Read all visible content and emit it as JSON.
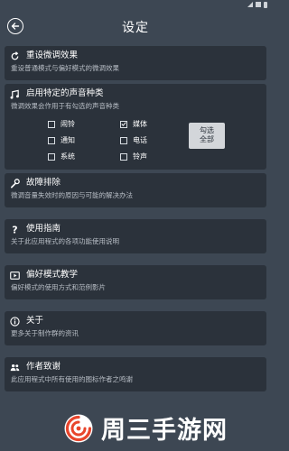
{
  "header": {
    "title": "设定"
  },
  "items": [
    {
      "title": "重设微调效果",
      "desc": "重设普通模式与偏好模式的微调效果"
    },
    {
      "title": "启用特定的声音种类",
      "desc": "微调效果会作用于有勾选的声音种类"
    },
    {
      "title": "故障排除",
      "desc": "微调音量失效时的原因与可能的解决办法"
    },
    {
      "title": "使用指南",
      "desc": "关于此应用程式的各项功能使用说明"
    },
    {
      "title": "偏好模式教学",
      "desc": "偏好模式的使用方式和范例影片"
    },
    {
      "title": "关于",
      "desc": "更多关于制作群的资讯"
    },
    {
      "title": "作者致谢",
      "desc": "此应用程式中所有使用的图标作者之鸣谢"
    }
  ],
  "sound_types": [
    {
      "label": "闹铃",
      "checked": false
    },
    {
      "label": "媒体",
      "checked": true
    },
    {
      "label": "通知",
      "checked": false
    },
    {
      "label": "电话",
      "checked": false
    },
    {
      "label": "系统",
      "checked": false
    },
    {
      "label": "铃声",
      "checked": false
    }
  ],
  "select_all": {
    "line1": "勾选",
    "line2": "全部"
  },
  "watermark": {
    "text": "周三手游网"
  },
  "colors": {
    "background": "#3d4753",
    "card": "#2b323b",
    "accent": "#e8452c"
  }
}
